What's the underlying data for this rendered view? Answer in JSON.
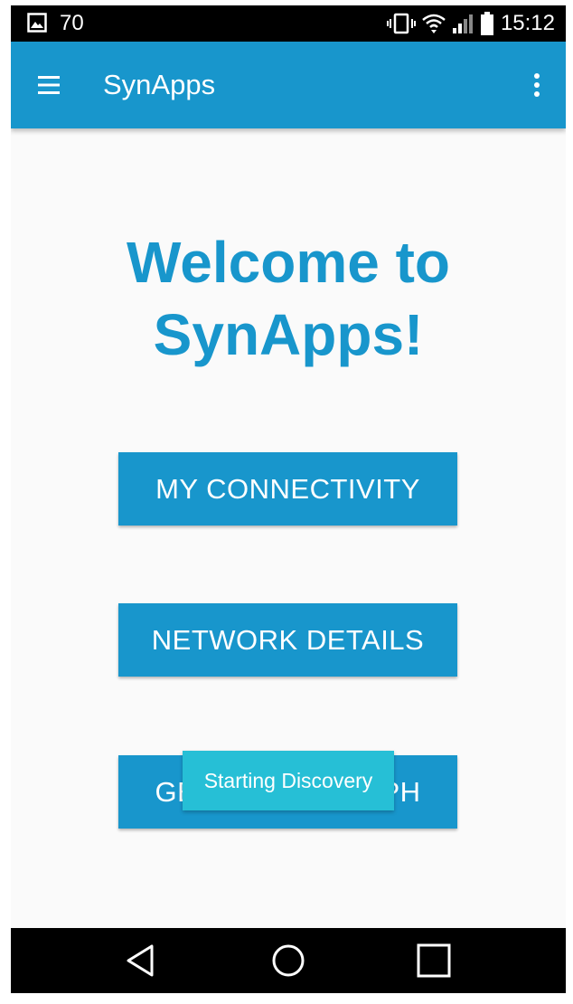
{
  "status_bar": {
    "notification_count": "70",
    "time": "15:12",
    "icons": [
      "gallery-icon",
      "vibrate-icon",
      "wifi-icon",
      "signal-icon",
      "battery-icon"
    ]
  },
  "app_bar": {
    "title": "SynApps",
    "menu_icon": "hamburger-menu-icon",
    "overflow_icon": "more-vert-icon",
    "color": "#1896cc"
  },
  "main": {
    "welcome_line1": "Welcome to",
    "welcome_line2": "SynApps!",
    "buttons": [
      {
        "label": "MY CONNECTIVITY"
      },
      {
        "label": "NETWORK DETAILS"
      },
      {
        "label": "GENERATE GRAPH"
      }
    ]
  },
  "toast": {
    "message": "Starting Discovery",
    "color": "#26bfd6"
  },
  "nav_bar": {
    "icons": [
      "back-icon",
      "home-icon",
      "recents-icon"
    ]
  }
}
